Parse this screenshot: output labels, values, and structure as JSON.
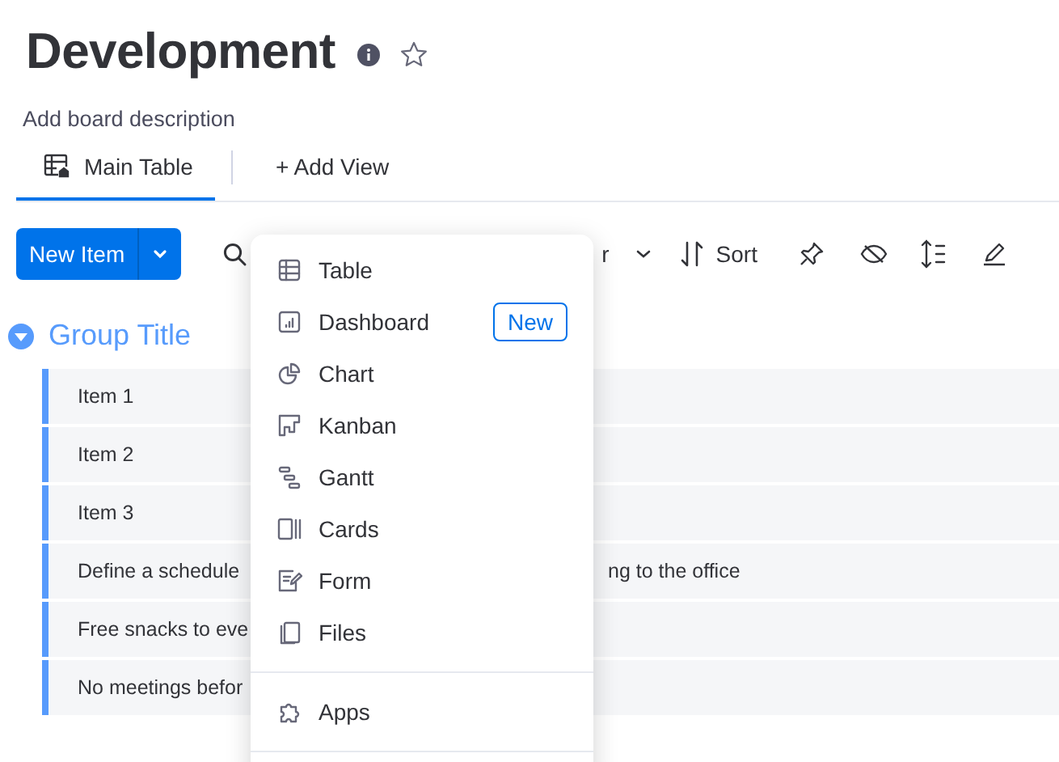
{
  "board": {
    "title": "Development",
    "description": "Add board description"
  },
  "views": [
    {
      "label": "Main Table",
      "kind": "table",
      "selected": true
    },
    {
      "label": "+ Add View",
      "kind": "add",
      "selected": false
    }
  ],
  "toolbar": {
    "new_item": "New Item",
    "filter_fragment": "r",
    "sort": "Sort"
  },
  "group": {
    "title": "Group Title",
    "color": "#579bfc",
    "expanded": true
  },
  "rows": [
    {
      "text": "Item 1"
    },
    {
      "text": "Item 2"
    },
    {
      "text": "Item 3"
    },
    {
      "text": "Define a schedule",
      "text_right": "ng to the office"
    },
    {
      "text": "Free snacks to eve"
    },
    {
      "text": "No meetings befor"
    }
  ],
  "view_menu": {
    "sections": [
      [
        {
          "label": "Table",
          "kind": "table"
        },
        {
          "label": "Dashboard",
          "kind": "dashboard",
          "badge": "New"
        },
        {
          "label": "Chart",
          "kind": "chart"
        },
        {
          "label": "Kanban",
          "kind": "kanban"
        },
        {
          "label": "Gantt",
          "kind": "gantt"
        },
        {
          "label": "Cards",
          "kind": "cards"
        },
        {
          "label": "Form",
          "kind": "form"
        },
        {
          "label": "Files",
          "kind": "files"
        }
      ],
      [
        {
          "label": "Apps",
          "kind": "apps"
        }
      ]
    ]
  }
}
